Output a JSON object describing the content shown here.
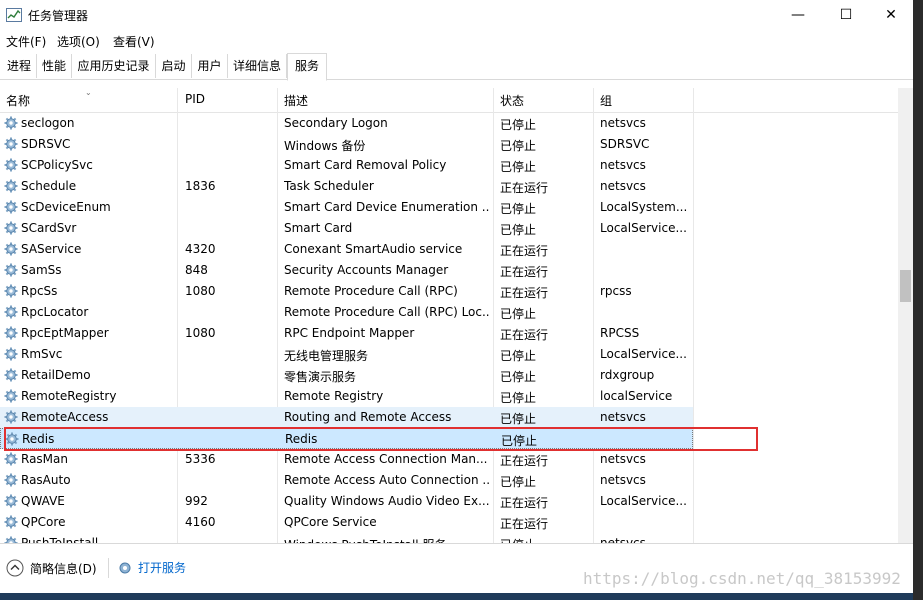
{
  "window": {
    "title": "任务管理器",
    "min_glyph": "—",
    "max_glyph": "☐",
    "close_glyph": "✕"
  },
  "menu": [
    "文件(F)",
    "选项(O)",
    "查看(V)"
  ],
  "tabs": [
    "进程",
    "性能",
    "应用历史记录",
    "启动",
    "用户",
    "详细信息",
    "服务"
  ],
  "active_tab": "服务",
  "columns": [
    "名称",
    "PID",
    "描述",
    "状态",
    "组"
  ],
  "rows": [
    {
      "name": "seclogon",
      "pid": "",
      "desc": "Secondary Logon",
      "status": "已停止",
      "group": "netsvcs"
    },
    {
      "name": "SDRSVC",
      "pid": "",
      "desc": "Windows 备份",
      "status": "已停止",
      "group": "SDRSVC"
    },
    {
      "name": "SCPolicySvc",
      "pid": "",
      "desc": "Smart Card Removal Policy",
      "status": "已停止",
      "group": "netsvcs"
    },
    {
      "name": "Schedule",
      "pid": "1836",
      "desc": "Task Scheduler",
      "status": "正在运行",
      "group": "netsvcs"
    },
    {
      "name": "ScDeviceEnum",
      "pid": "",
      "desc": "Smart Card Device Enumeration ...",
      "status": "已停止",
      "group": "LocalSystem..."
    },
    {
      "name": "SCardSvr",
      "pid": "",
      "desc": "Smart Card",
      "status": "已停止",
      "group": "LocalService..."
    },
    {
      "name": "SAService",
      "pid": "4320",
      "desc": "Conexant SmartAudio service",
      "status": "正在运行",
      "group": ""
    },
    {
      "name": "SamSs",
      "pid": "848",
      "desc": "Security Accounts Manager",
      "status": "正在运行",
      "group": ""
    },
    {
      "name": "RpcSs",
      "pid": "1080",
      "desc": "Remote Procedure Call (RPC)",
      "status": "正在运行",
      "group": "rpcss"
    },
    {
      "name": "RpcLocator",
      "pid": "",
      "desc": "Remote Procedure Call (RPC) Loc...",
      "status": "已停止",
      "group": ""
    },
    {
      "name": "RpcEptMapper",
      "pid": "1080",
      "desc": "RPC Endpoint Mapper",
      "status": "正在运行",
      "group": "RPCSS"
    },
    {
      "name": "RmSvc",
      "pid": "",
      "desc": "无线电管理服务",
      "status": "已停止",
      "group": "LocalService..."
    },
    {
      "name": "RetailDemo",
      "pid": "",
      "desc": "零售演示服务",
      "status": "已停止",
      "group": "rdxgroup"
    },
    {
      "name": "RemoteRegistry",
      "pid": "",
      "desc": "Remote Registry",
      "status": "已停止",
      "group": "localService"
    },
    {
      "name": "RemoteAccess",
      "pid": "",
      "desc": "Routing and Remote Access",
      "status": "已停止",
      "group": "netsvcs"
    },
    {
      "name": "Redis",
      "pid": "",
      "desc": "Redis",
      "status": "已停止",
      "group": ""
    },
    {
      "name": "RasMan",
      "pid": "5336",
      "desc": "Remote Access Connection Man...",
      "status": "正在运行",
      "group": "netsvcs"
    },
    {
      "name": "RasAuto",
      "pid": "",
      "desc": "Remote Access Auto Connection ...",
      "status": "已停止",
      "group": "netsvcs"
    },
    {
      "name": "QWAVE",
      "pid": "992",
      "desc": "Quality Windows Audio Video Ex...",
      "status": "正在运行",
      "group": "LocalService..."
    },
    {
      "name": "QPCore",
      "pid": "4160",
      "desc": "QPCore Service",
      "status": "正在运行",
      "group": ""
    },
    {
      "name": "PushToInstall",
      "pid": "",
      "desc": "Windows PushToInstall 服务",
      "status": "已停止",
      "group": "netsvcs"
    }
  ],
  "hovered_row": "RemoteAccess",
  "selected_row": "Redis",
  "footer": {
    "less_details": "简略信息(D)",
    "open_services": "打开服务"
  },
  "watermark": "https://blog.csdn.net/qq_38153992",
  "colors": {
    "annotation_red": "#e03030",
    "selection": "#cce8ff",
    "hover": "#e5f1fb",
    "link_blue": "#0066cc"
  }
}
